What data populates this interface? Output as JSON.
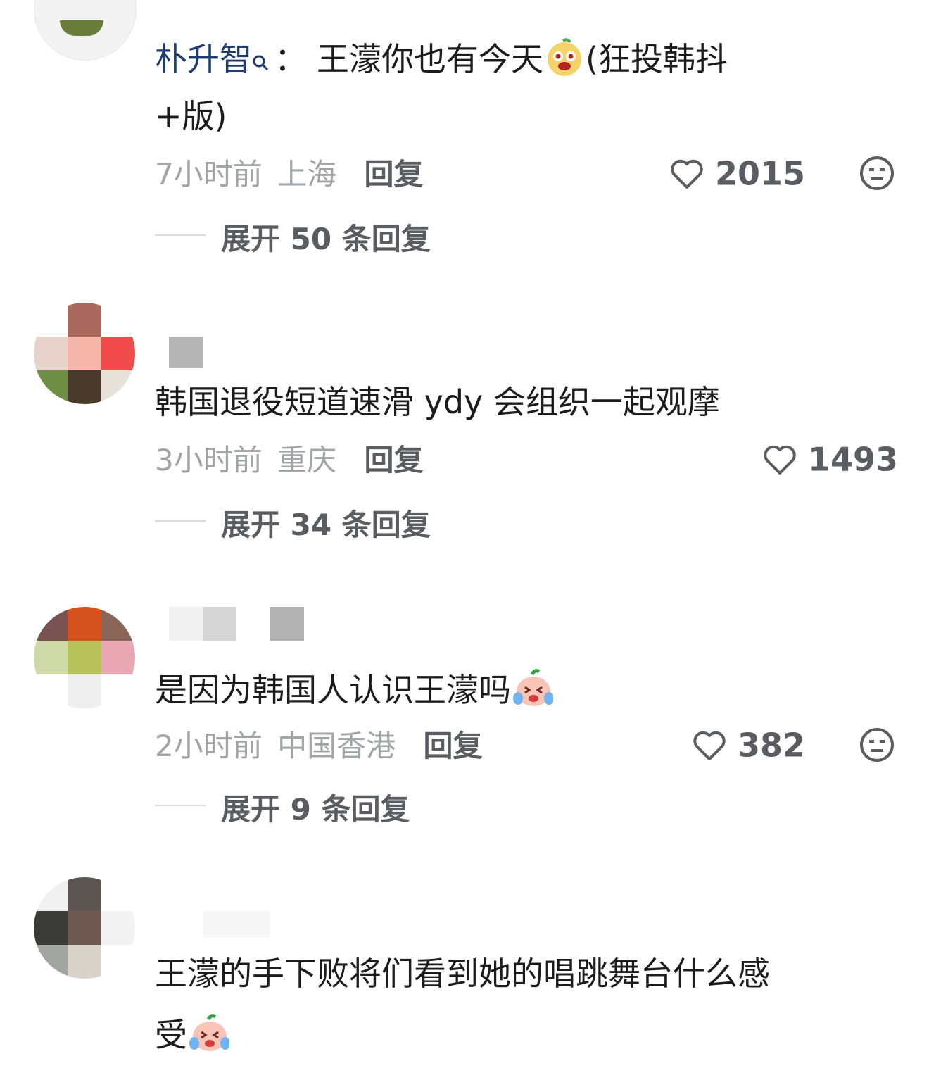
{
  "comments": [
    {
      "username": "朴升智",
      "separator": "：",
      "text": "王濛你也有今天",
      "text_suffix": "(狂投韩抖",
      "text_line2": "+版)",
      "time": "7小时前",
      "location": "上海",
      "reply": "回复",
      "likes": "2015",
      "expand": "展开 50 条回复"
    },
    {
      "text": "韩国退役短道速滑 ydy 会组织一起观摩",
      "time": "3小时前",
      "location": "重庆",
      "reply": "回复",
      "likes": "1493",
      "expand": "展开 34 条回复"
    },
    {
      "text": "是因为韩国人认识王濛吗",
      "time": "2小时前",
      "location": "中国香港",
      "reply": "回复",
      "likes": "382",
      "expand": "展开 9 条回复"
    },
    {
      "text": "王濛的手下败将们看到她的唱跳舞台什么感",
      "text_line2": "受"
    }
  ],
  "colors": {
    "username": "#1e3a6e",
    "meta": "#a3a4a8",
    "action": "#5b5c61"
  }
}
